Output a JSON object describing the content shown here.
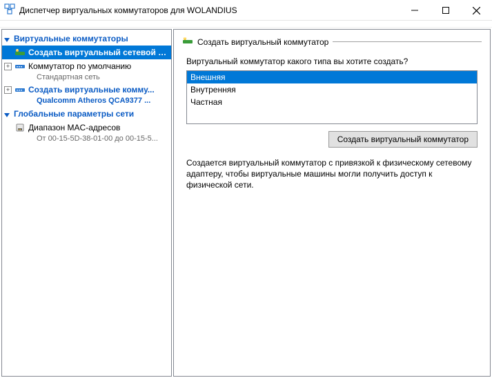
{
  "window": {
    "title": "Диспетчер виртуальных коммутаторов для WOLANDIUS"
  },
  "tree": {
    "section_switches": "Виртуальные коммутаторы",
    "item_new": "Создать виртуальный сетевой к...",
    "item_default": "Коммутатор по умолчанию",
    "item_default_sub": "Стандартная сеть",
    "item_create": "Создать виртуальные комму...",
    "item_create_sub": "Qualcomm Atheros QCA9377 ...",
    "section_global": "Глобальные параметры сети",
    "item_mac": "Диапазон MAC-адресов",
    "item_mac_sub": "От 00-15-5D-38-01-00 до 00-15-5..."
  },
  "panel": {
    "header": "Создать виртуальный коммутатор",
    "prompt": "Виртуальный коммутатор какого типа вы хотите создать?",
    "options": {
      "external": "Внешняя",
      "internal": "Внутренняя",
      "private": "Частная"
    },
    "button": "Создать виртуальный коммутатор",
    "description": "Создается виртуальный коммутатор с привязкой к физическому сетевому адаптеру, чтобы виртуальные машины могли получить доступ к физической сети."
  }
}
